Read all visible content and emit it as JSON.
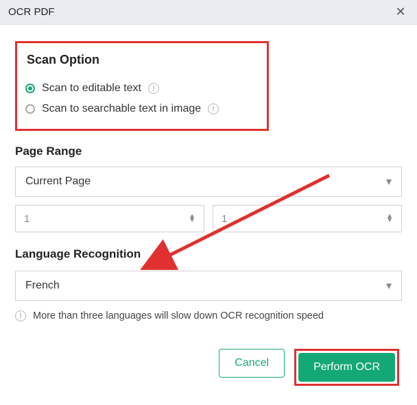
{
  "header": {
    "title": "OCR PDF",
    "close_glyph": "✕"
  },
  "scan_option": {
    "title": "Scan Option",
    "options": [
      {
        "label": "Scan to editable text",
        "selected": true
      },
      {
        "label": "Scan to searchable text in image",
        "selected": false
      }
    ]
  },
  "page_range": {
    "title": "Page Range",
    "selected": "Current Page",
    "from_value": "1",
    "to_value": "1"
  },
  "language": {
    "title": "Language Recognition",
    "selected": "French",
    "warning": "More than three languages will slow down OCR recognition speed"
  },
  "buttons": {
    "cancel": "Cancel",
    "primary": "Perform OCR"
  },
  "glyphs": {
    "info": "!",
    "chevron_down": "▾",
    "arrow_up": "▲",
    "arrow_down": "▼"
  }
}
